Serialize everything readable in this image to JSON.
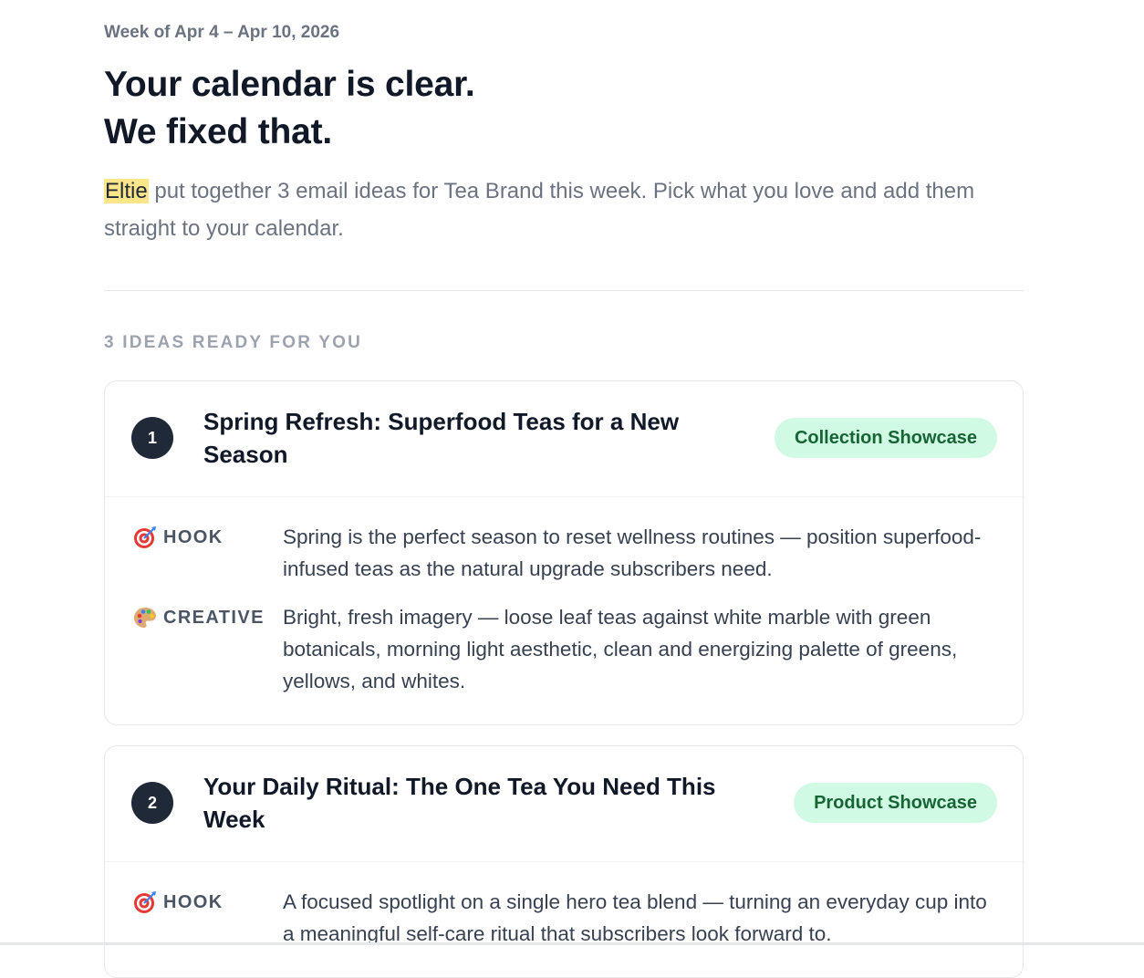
{
  "header": {
    "week": "Week of Apr 4 – Apr 10, 2026",
    "headline_line1": "Your calendar is clear.",
    "headline_line2": "We fixed that.",
    "intro_highlight": "Eltie",
    "intro_rest": " put together 3 email ideas for Tea Brand this week. Pick what you love and add them straight to your calendar."
  },
  "section": {
    "label": "3 IDEAS READY FOR YOU"
  },
  "ideas": [
    {
      "number": "1",
      "title": "Spring Refresh: Superfood Teas for a New Season",
      "tag": "Collection Showcase",
      "hook_label": "HOOK",
      "hook_icon": "target-icon",
      "hook": "Spring is the perfect season to reset wellness routines — position superfood-infused teas as the natural upgrade subscribers need.",
      "creative_label": "CREATIVE",
      "creative_icon": "palette-icon",
      "creative": "Bright, fresh imagery — loose leaf teas against white marble with green botanicals, morning light aesthetic, clean and energizing palette of greens, yellows, and whites."
    },
    {
      "number": "2",
      "title": "Your Daily Ritual: The One Tea You Need This Week",
      "tag": "Product Showcase",
      "hook_label": "HOOK",
      "hook_icon": "target-icon",
      "hook": "A focused spotlight on a single hero tea blend — turning an everyday cup into a meaningful self-care ritual that subscribers look forward to."
    }
  ],
  "colors": {
    "badge_bg": "#d1fae5",
    "badge_text": "#166534",
    "number_bg": "#1f2937",
    "highlight": "#fde68a"
  }
}
